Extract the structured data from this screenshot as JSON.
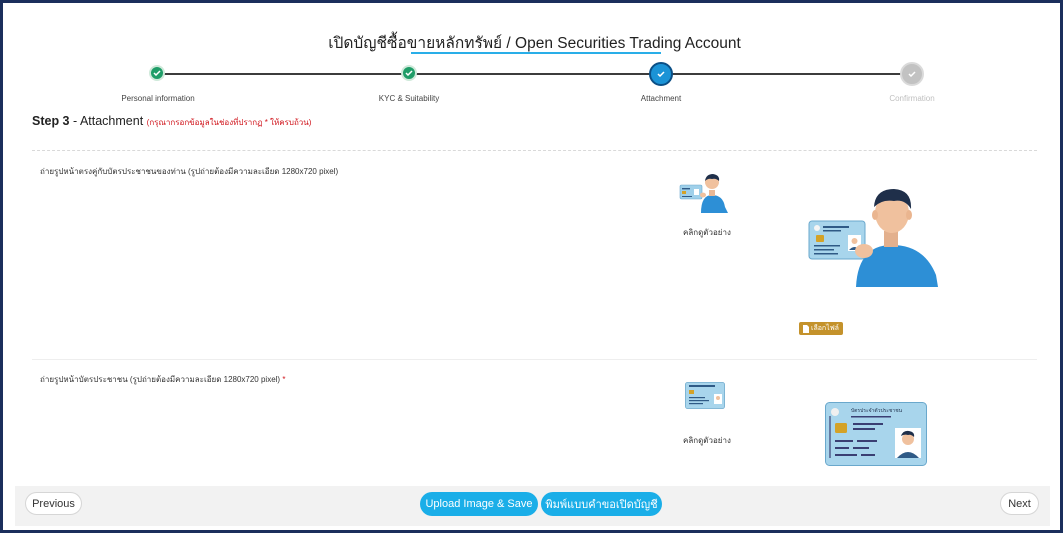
{
  "page": {
    "title": "เปิดบัญชีซื้อขายหลักทรัพย์ / Open Securities Trading Account"
  },
  "steps": [
    {
      "label": "Personal information",
      "state": "done"
    },
    {
      "label": "KYC & Suitability",
      "state": "done"
    },
    {
      "label": "Attachment",
      "state": "current"
    },
    {
      "label": "Confirmation",
      "state": "todo"
    }
  ],
  "heading": {
    "step": "Step 3",
    "separator": " - ",
    "name": "Attachment",
    "note": "(กรุณากรอกข้อมูลในช่องที่ปรากฏ * ให้ครบถ้วน)"
  },
  "sections": [
    {
      "label": "ถ่ายรูปหน้าตรงคู่กับบัตรประชาชนของท่าน (รูปถ่ายต้องมีความละเอียด 1280x720 pixel)",
      "example_text": "คลิกดูตัวอย่าง",
      "file_button": "เลือกไฟล์"
    },
    {
      "label": "ถ่ายรูปหน้าบัตรประชาชน (รูปถ่ายต้องมีความละเอียด 1280x720 pixel)",
      "required_mark": "*",
      "example_text": "คลิกดูตัวอย่าง",
      "card_title": "บัตรประจำตัวประชาชน"
    }
  ],
  "footer": {
    "previous": "Previous",
    "upload": "Upload Image & Save",
    "print": "พิมพ์แบบคำขอเปิดบัญชี",
    "next": "Next"
  },
  "colors": {
    "frame": "#1b2f5c",
    "done": "#1f9d68",
    "current": "#1b93d6",
    "todo": "#c2c2c2",
    "accent": "#1aaee8",
    "required": "#d0141b",
    "file_button": "#c4922b"
  }
}
